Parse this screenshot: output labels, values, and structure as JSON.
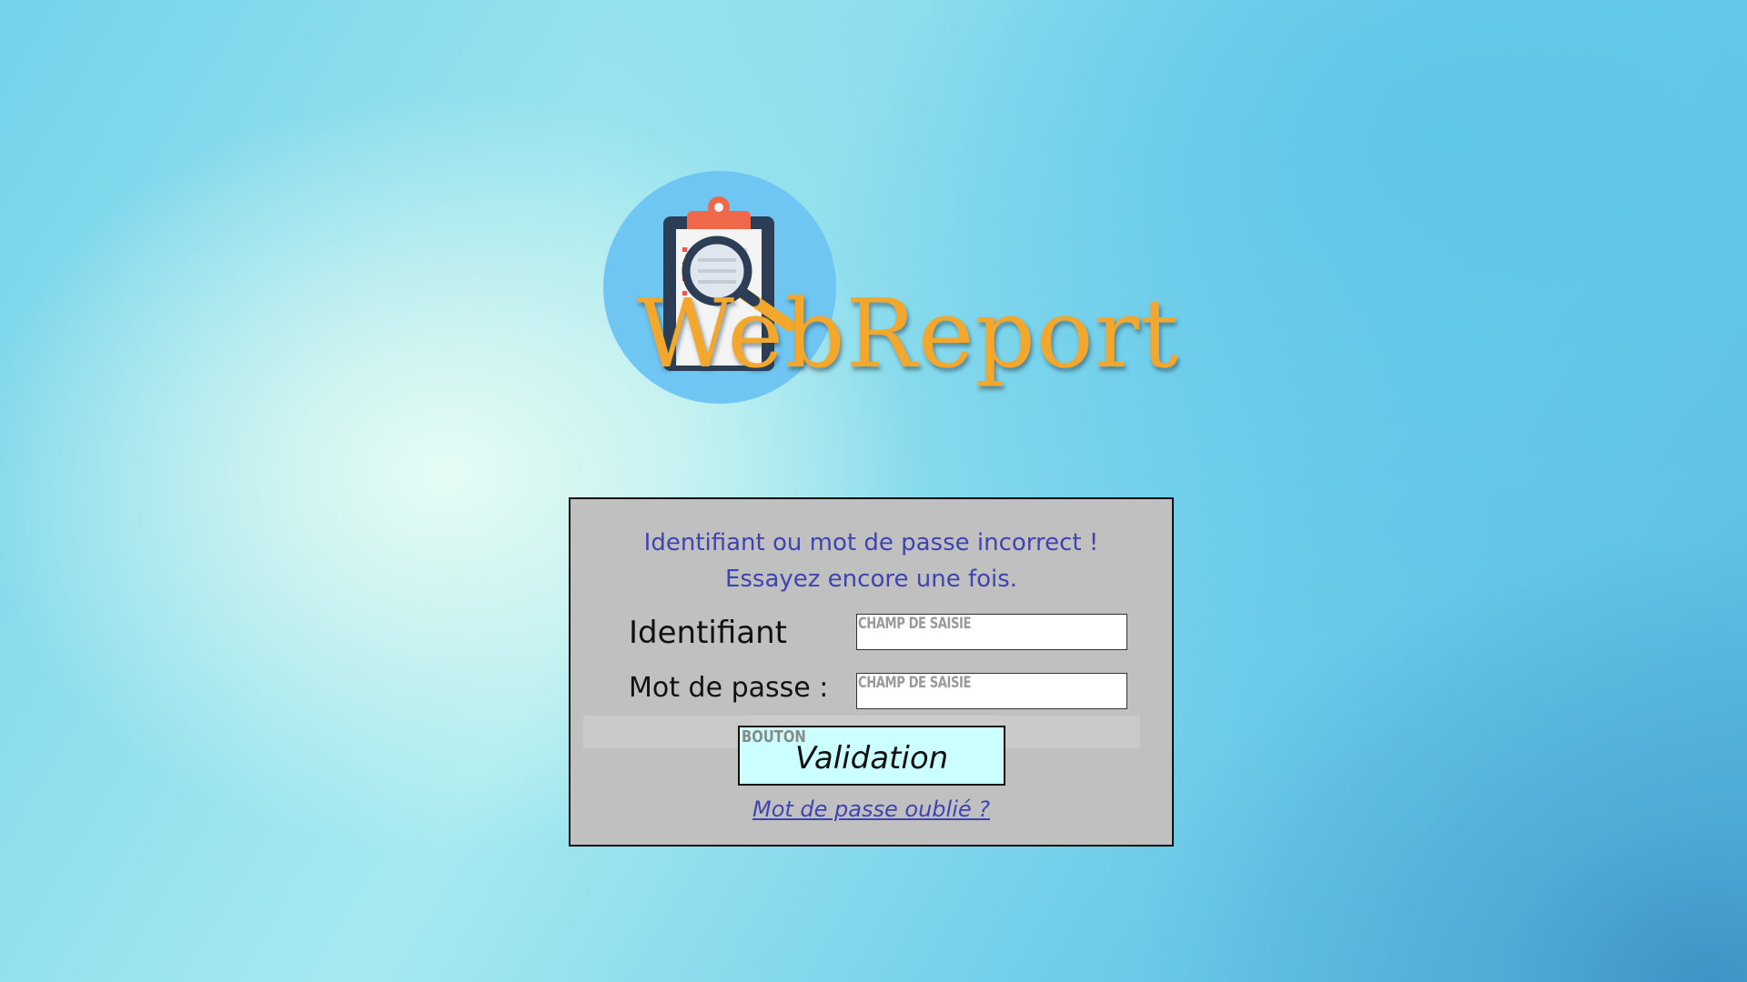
{
  "app": {
    "logo_text": "WebReport"
  },
  "login": {
    "error_line1": "Identifiant ou mot de passe incorrect !",
    "error_line2": "Essayez encore une fois.",
    "username_label": "Identifiant",
    "username_field_tag": "CHAMP DE SAISIE",
    "password_label": "Mot de passe :",
    "password_field_tag": "CHAMP DE SAISIE",
    "button_tag": "BOUTON",
    "submit_label": "Validation",
    "forgot_link": "Mot de passe oublié ?"
  },
  "colors": {
    "logo_text": "#f3a72c",
    "panel_background": "#c0c0c0",
    "error_text": "#4044b0",
    "button_background": "#ccffff",
    "badge_circle": "#6fc6f2",
    "clipboard_clip": "#f0684a"
  },
  "icons": {
    "logo_badge": "clipboard-magnifier-icon"
  }
}
